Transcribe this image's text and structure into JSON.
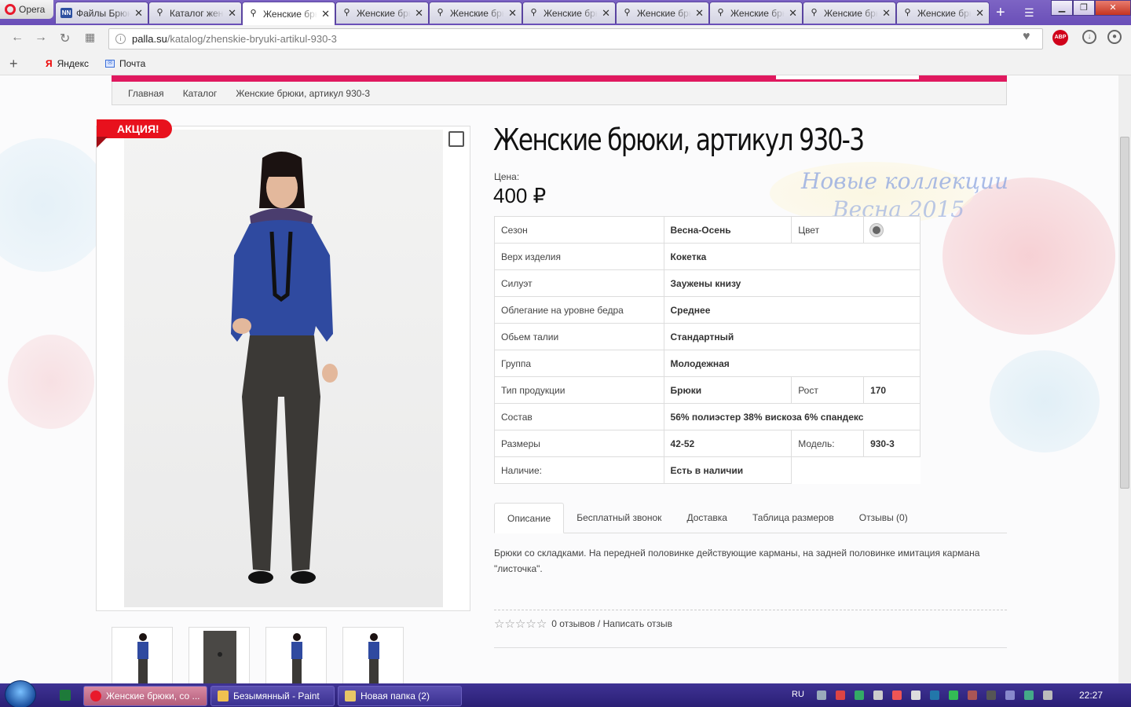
{
  "browser": {
    "menu_label": "Opera",
    "tabs": [
      {
        "title": "Файлы Брюки",
        "icon": "NN"
      },
      {
        "title": "Каталог женской",
        "icon": "shop"
      },
      {
        "title": "Женские брюки",
        "icon": "shop",
        "active": true
      },
      {
        "title": "Женские брюки",
        "icon": "shop"
      },
      {
        "title": "Женские брюки",
        "icon": "shop"
      },
      {
        "title": "Женские брюки",
        "icon": "shop"
      },
      {
        "title": "Женские брюки",
        "icon": "shop"
      },
      {
        "title": "Женские брюки",
        "icon": "shop"
      },
      {
        "title": "Женские брюки",
        "icon": "shop"
      },
      {
        "title": "Женские брюки",
        "icon": "shop"
      }
    ],
    "url_host": "palla.su",
    "url_path": "/katalog/zhenskie-bryuki-artikul-930-3",
    "bookmarks": [
      {
        "label": "Яндекс",
        "icon": "Я"
      },
      {
        "label": "Почта",
        "icon": "mail"
      }
    ],
    "abp_label": "ABP"
  },
  "breadcrumbs": [
    "Главная",
    "Каталог",
    "Женские брюки, артикул 930-3"
  ],
  "product": {
    "badge": "АКЦИЯ!",
    "title": "Женские брюки, артикул 930-3",
    "price_label": "Цена:",
    "price": "400 ₽",
    "promo_line1": "Новые коллекции",
    "promo_line2": "Весна 2015",
    "specs": [
      {
        "label": "Сезон",
        "value": "Весна-Осень",
        "label2": "Цвет",
        "value2": "color-dot"
      },
      {
        "label": "Верх изделия",
        "value": "Кокетка"
      },
      {
        "label": "Силуэт",
        "value": "Заужены книзу"
      },
      {
        "label": "Облегание на уровне бедра",
        "value": "Среднее"
      },
      {
        "label": "Обьем талии",
        "value": "Стандартный"
      },
      {
        "label": "Группа",
        "value": "Молодежная"
      },
      {
        "label": "Тип продукции",
        "value": "Брюки",
        "label2": "Рост",
        "value2": "170"
      },
      {
        "label": "Состав",
        "value": "56% полиэстер 38% вискоза 6% спандекс"
      },
      {
        "label": "Размеры",
        "value": "42-52",
        "label2": "Модель:",
        "value2": "930-3"
      },
      {
        "label": "Наличие:",
        "value": "Есть в наличии"
      }
    ],
    "tabs": [
      "Описание",
      "Бесплатный звонок",
      "Доставка",
      "Таблица размеров",
      "Отзывы (0)"
    ],
    "description": "Брюки со складками. На передней половинке действующие карманы, на задней половинке имитация кармана \"листочка\".",
    "rating_text": "0 отзывов / Написать отзыв",
    "stars": 5
  },
  "taskbar": {
    "items": [
      {
        "label": "Женские брюки, со ...",
        "active": true
      },
      {
        "label": "Безымянный - Paint"
      },
      {
        "label": "Новая папка (2)"
      }
    ],
    "lang": "RU",
    "clock": "22:27"
  },
  "colors": {
    "accent": "#e0195f",
    "tabbar": "#6a4fb8",
    "badge": "#e8111d"
  }
}
